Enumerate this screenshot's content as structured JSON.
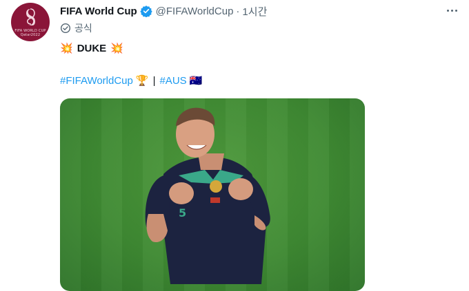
{
  "tweet": {
    "display_name": "FIFA World Cup",
    "handle": "@FIFAWorldCup",
    "separator": "·",
    "time": "1시간",
    "official_label": "공식",
    "avatar_caption": "FIFA WORLD CUP Qatar2022",
    "text_line1": {
      "emoji_left": "💥",
      "word": "DUKE",
      "emoji_right": "💥"
    },
    "text_line2": {
      "hashtag1": "#FIFAWorldCup",
      "trophy_emoji": "🏆",
      "divider": "|",
      "hashtag2": "#AUS",
      "flag_emoji": "🇦🇺"
    },
    "media": {
      "description_icon": "photo-of-celebrating-player"
    }
  },
  "colors": {
    "verified": "#1d9bf0",
    "hashtag": "#1d9bf0",
    "avatar_bg": "#8a1538",
    "muted_text": "#536471"
  }
}
